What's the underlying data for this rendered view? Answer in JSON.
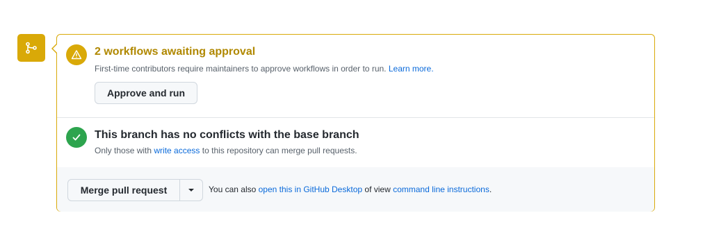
{
  "colors": {
    "warning": "#d9a908",
    "warning_text": "#b08800",
    "success": "#2da44e",
    "link": "#0969da"
  },
  "icons": {
    "badge": "git-merge-icon",
    "approval": "alert-triangle-icon",
    "conflicts": "check-icon",
    "merge_dropdown": "triangle-down-icon"
  },
  "approval": {
    "title": "2 workflows awaiting approval",
    "description": "First-time contributors require maintainers to approve workflows in order to run.",
    "learn_more": "Learn more.",
    "button_label": "Approve and run"
  },
  "conflicts": {
    "title": "This branch has no conflicts with the base branch",
    "description_prefix": "Only those with",
    "write_access_link": "write access",
    "description_suffix": "to this repository can merge pull requests."
  },
  "merge": {
    "button_label": "Merge pull request",
    "hint_prefix": "You can also",
    "desktop_link": "open this in GitHub Desktop",
    "hint_middle": "of view",
    "cli_link": "command line instructions",
    "hint_suffix": "."
  }
}
